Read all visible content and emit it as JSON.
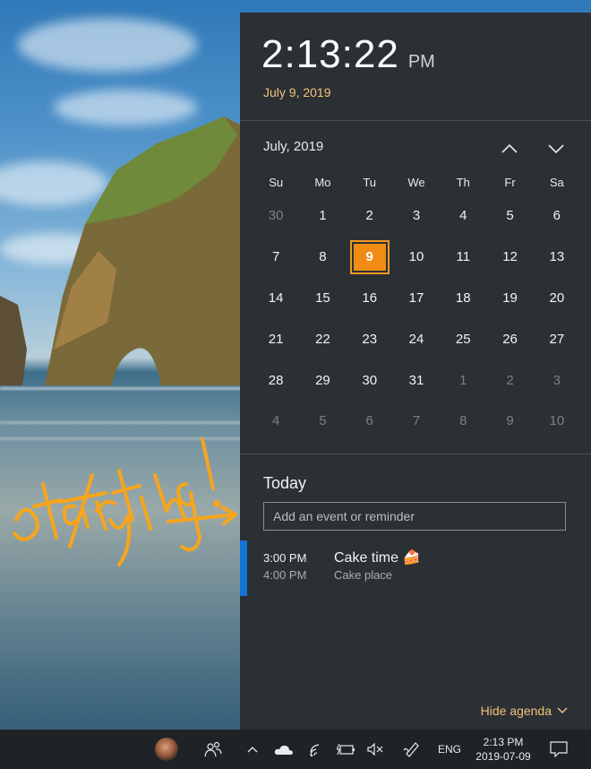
{
  "clock": {
    "time": "2:13:22",
    "ampm": "PM",
    "date": "July 9, 2019"
  },
  "calendar": {
    "month_label": "July, 2019",
    "weekdays": [
      "Su",
      "Mo",
      "Tu",
      "We",
      "Th",
      "Fr",
      "Sa"
    ],
    "weeks": [
      [
        "30",
        "1",
        "2",
        "3",
        "4",
        "5",
        "6"
      ],
      [
        "7",
        "8",
        "9",
        "10",
        "11",
        "12",
        "13"
      ],
      [
        "14",
        "15",
        "16",
        "17",
        "18",
        "19",
        "20"
      ],
      [
        "21",
        "22",
        "23",
        "24",
        "25",
        "26",
        "27"
      ],
      [
        "28",
        "29",
        "30",
        "31",
        "1",
        "2",
        "3"
      ],
      [
        "4",
        "5",
        "6",
        "7",
        "8",
        "9",
        "10"
      ]
    ],
    "today": "9",
    "accent_color": "#f08c14"
  },
  "agenda": {
    "heading": "Today",
    "input_placeholder": "Add an event or reminder",
    "event": {
      "start": "3:00 PM",
      "end": "4:00 PM",
      "title": "Cake time 🍰",
      "location": "Cake place",
      "color": "#1473d6"
    },
    "hide_label": "Hide agenda"
  },
  "annotation": {
    "text": "start typing!"
  },
  "taskbar": {
    "language": "ENG",
    "time": "2:13 PM",
    "date": "2019-07-09"
  }
}
